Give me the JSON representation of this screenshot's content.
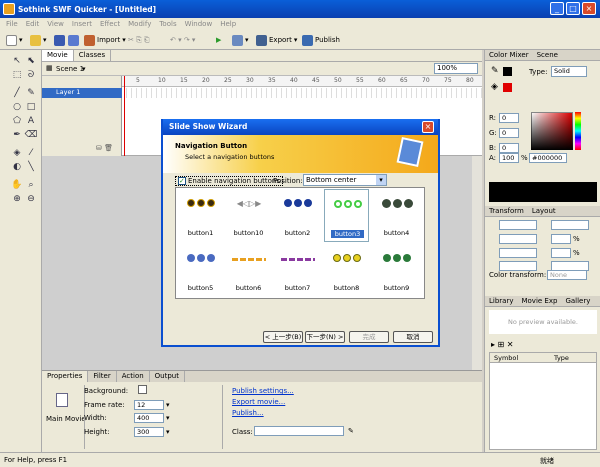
{
  "window": {
    "title": "Sothink SWF Quicker - [Untitled]"
  },
  "menu": [
    "File",
    "Edit",
    "View",
    "Insert",
    "Effect",
    "Modify",
    "Tools",
    "Window",
    "Help"
  ],
  "toolbar": {
    "import": "Import",
    "export": "Export",
    "publish": "Publish"
  },
  "timeline": {
    "tabs": [
      "Movie",
      "Classes"
    ],
    "scene": "Scene 1",
    "layer": "Layer 1",
    "zoom": "100%",
    "frames": [
      "5",
      "10",
      "15",
      "20",
      "25",
      "30",
      "35",
      "40",
      "45",
      "50",
      "55",
      "60",
      "65",
      "70",
      "75",
      "80"
    ]
  },
  "dialog": {
    "title": "Slide Show Wizard",
    "heading": "Navigation Button",
    "subheading": "Select a navigation buttons",
    "enable_label": "Enable navigation buttons",
    "position_label": "Position:",
    "position_value": "Bottom center",
    "buttons": [
      "button1",
      "button10",
      "button2",
      "button3",
      "button4",
      "button5",
      "button6",
      "button7",
      "button8",
      "button9"
    ],
    "selected": "button3",
    "back": "< 上一步(B)",
    "next": "下一步(N) >",
    "finish": "完成",
    "cancel": "取消"
  },
  "properties": {
    "tabs": [
      "Properties",
      "Filter",
      "Action",
      "Output"
    ],
    "main_movie": "Main Movie",
    "background_label": "Background:",
    "frame_rate_label": "Frame rate:",
    "frame_rate": "12",
    "width_label": "Width:",
    "width": "400",
    "height_label": "Height:",
    "height": "300",
    "publish_settings": "Publish settings...",
    "export_movie": "Export movie...",
    "publish": "Publish...",
    "class_label": "Class:"
  },
  "color_mixer": {
    "tabs": [
      "Color Mixer",
      "Scene"
    ],
    "type_label": "Type:",
    "type": "Solid",
    "r": "0",
    "g": "0",
    "b": "0",
    "alpha": "100",
    "alpha_unit": "%",
    "hex": "#000000",
    "r_label": "R:",
    "g_label": "G:",
    "b_label": "B:",
    "a_label": "A:"
  },
  "transform": {
    "tabs": [
      "Transform",
      "Layout"
    ],
    "color_transform_label": "Color transform:",
    "color_transform": "None",
    "pct": "%"
  },
  "library": {
    "tabs": [
      "Library",
      "Movie Exp",
      "Gallery"
    ],
    "preview": "No preview available.",
    "col_symbol": "Symbol",
    "col_type": "Type"
  },
  "status": {
    "left": "For Help, press F1",
    "right": "就绪"
  },
  "colors": {
    "accent": "#0a4fd0",
    "selection": "#316ac5"
  }
}
